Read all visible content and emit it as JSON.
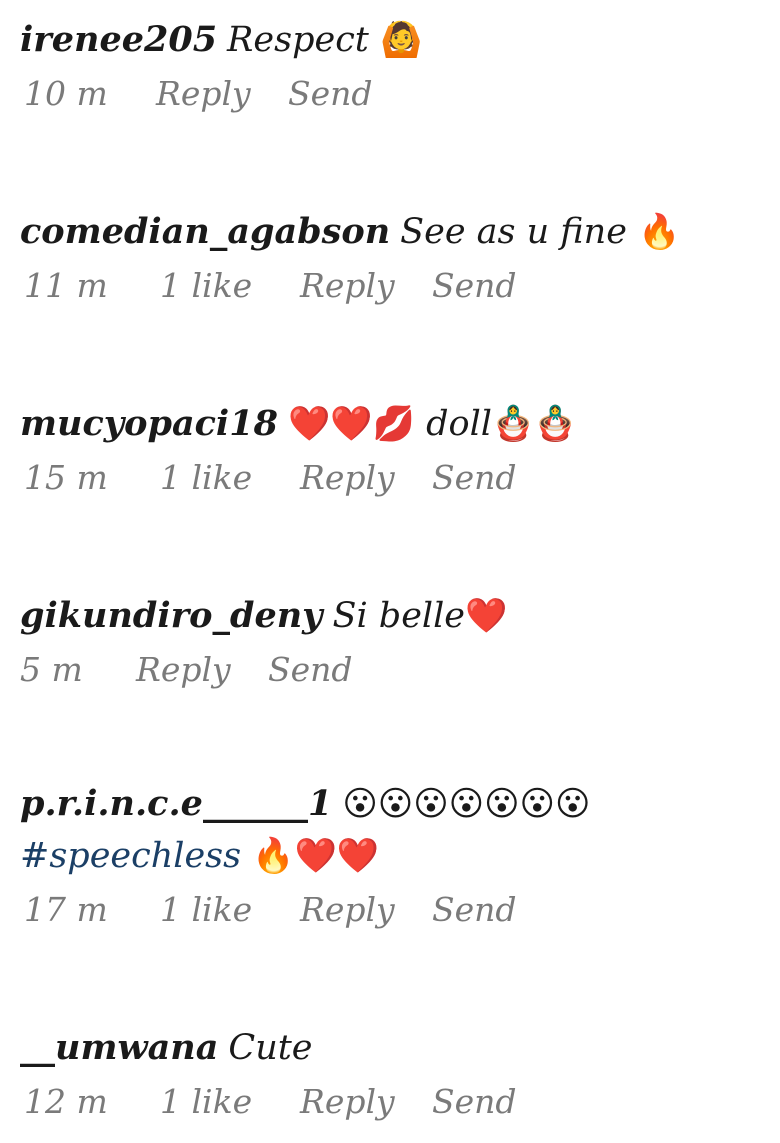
{
  "comments": [
    {
      "username": "irenee205",
      "text": "Respect",
      "emoji": "🙆",
      "time": "10 m",
      "likes": "",
      "reply_label": "Reply",
      "send_label": "Send"
    },
    {
      "username": "comedian_agabson",
      "text": "See as u fine",
      "emoji": "🔥",
      "time": "11 m",
      "likes": "1 like",
      "reply_label": "Reply",
      "send_label": "Send"
    },
    {
      "username": "mucyopaci18",
      "text_pre": "❤️❤️💋",
      "text": "doll",
      "emoji": "🪆🪆",
      "time": "15 m",
      "likes": "1 like",
      "reply_label": "Reply",
      "send_label": "Send"
    },
    {
      "username": "gikundiro_deny",
      "text": "Si belle",
      "emoji": "❤️",
      "time": "5 m",
      "likes": "",
      "reply_label": "Reply",
      "send_label": "Send"
    },
    {
      "username": "p.r.i.n.c.e______1",
      "text_pre": "😮😮😮😮😮😮😮",
      "hashtag": "#speechless",
      "emoji": "🔥❤️❤️",
      "time": "17 m",
      "likes": "1 like",
      "reply_label": "Reply",
      "send_label": "Send"
    },
    {
      "username": "__umwana",
      "text": "Cute",
      "time": "12 m",
      "likes": "1 like",
      "reply_label": "Reply",
      "send_label": "Send"
    }
  ]
}
